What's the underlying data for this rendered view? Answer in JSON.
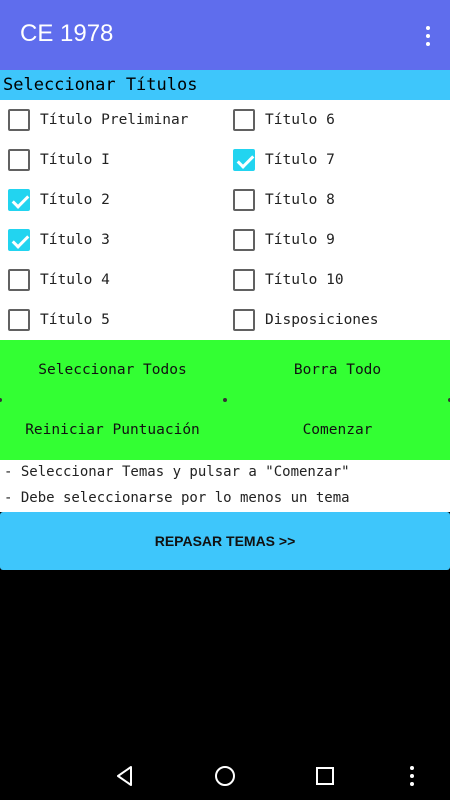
{
  "appbar": {
    "title": "CE 1978",
    "menu_icon": "more-vert-icon"
  },
  "section_header": "Seleccionar Títulos",
  "checkboxes": [
    {
      "label": "Título Preliminar",
      "checked": false
    },
    {
      "label": "Título I",
      "checked": false
    },
    {
      "label": "Título 2",
      "checked": true
    },
    {
      "label": "Título 3",
      "checked": true
    },
    {
      "label": "Título 4",
      "checked": false
    },
    {
      "label": "Título 5",
      "checked": false
    },
    {
      "label": "Título 6",
      "checked": false
    },
    {
      "label": "Título 7",
      "checked": true
    },
    {
      "label": "Título 8",
      "checked": false
    },
    {
      "label": "Título 9",
      "checked": false
    },
    {
      "label": "Título 10",
      "checked": false
    },
    {
      "label": "Disposiciones",
      "checked": false
    }
  ],
  "buttons": {
    "select_all": "Seleccionar Todos",
    "clear_all": "Borra Todo",
    "reset_score": "Reiniciar Puntuación",
    "start": "Comenzar"
  },
  "info": {
    "line1": "- Seleccionar Temas y pulsar a \"Comenzar\"",
    "line2": "- Debe seleccionarse por lo menos un tema"
  },
  "review_button": "REPASAR TEMAS >>",
  "colors": {
    "appbar": "#5f6ded",
    "header": "#3ec6fb",
    "buttons": "#33ff33",
    "checked": "#22d4f0"
  },
  "navbar": {
    "icons": [
      "back-icon",
      "home-icon",
      "recents-icon",
      "more-vert-icon"
    ]
  }
}
